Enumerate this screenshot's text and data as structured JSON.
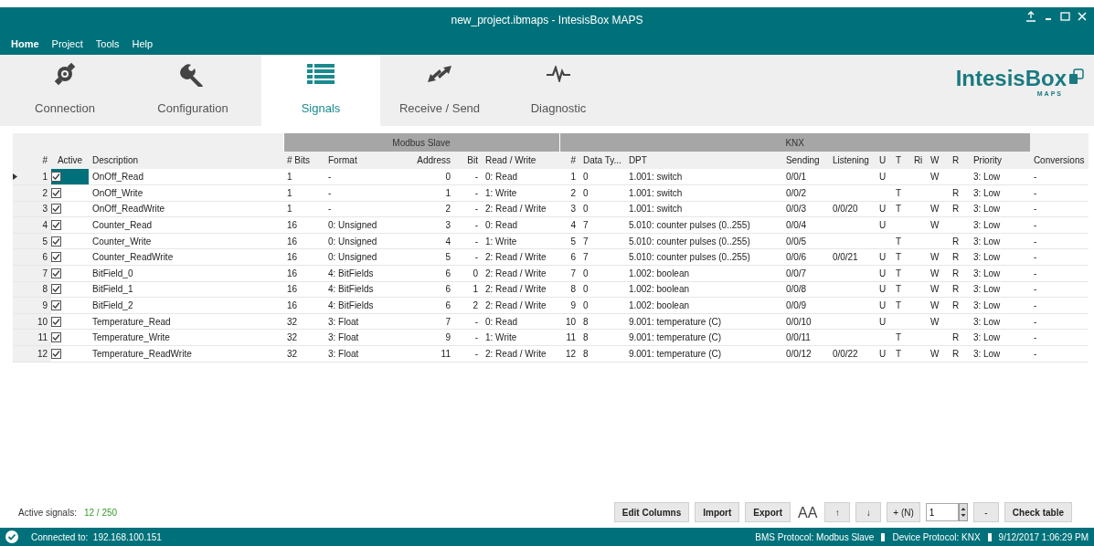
{
  "window": {
    "title": "new_project.ibmaps - IntesisBox MAPS"
  },
  "menu": [
    {
      "label": "Home",
      "selected": true
    },
    {
      "label": "Project",
      "selected": false
    },
    {
      "label": "Tools",
      "selected": false
    },
    {
      "label": "Help",
      "selected": false
    }
  ],
  "tabs": [
    {
      "label": "Connection",
      "kind": "connection",
      "selected": false
    },
    {
      "label": "Configuration",
      "kind": "configuration",
      "selected": false
    },
    {
      "label": "Signals",
      "kind": "signals",
      "selected": true
    },
    {
      "label": "Receive / Send",
      "kind": "receive",
      "selected": false
    },
    {
      "label": "Diagnostic",
      "kind": "diagnostic",
      "selected": false
    }
  ],
  "logo": {
    "name": "IntesisBox",
    "sub": "MAPS"
  },
  "table": {
    "sections": [
      {
        "columns": [
          "#",
          "Active",
          "Description"
        ]
      },
      {
        "label": "Modbus Slave",
        "columns": [
          "# Bits",
          "Format",
          "Address",
          "Bit",
          "Read / Write"
        ]
      },
      {
        "label": "KNX",
        "columns": [
          "#",
          "Data Ty...",
          "DPT",
          "Sending",
          "Listening",
          "U",
          "T",
          "Ri",
          "W",
          "R",
          "Priority"
        ]
      },
      {
        "columns": [
          "Conversions"
        ]
      }
    ],
    "rows": [
      {
        "selected": true,
        "active": true,
        "cells": [
          "1",
          "OnOff_Read",
          "1",
          "-",
          "0",
          "-",
          "0: Read",
          "1",
          "0",
          "1.001: switch",
          "0/0/1",
          null,
          "U",
          null,
          null,
          "W",
          null,
          "3: Low",
          "-"
        ]
      },
      {
        "selected": false,
        "active": true,
        "cells": [
          "2",
          "OnOff_Write",
          "1",
          "-",
          "1",
          "-",
          "1: Write",
          "2",
          "0",
          "1.001: switch",
          "0/0/2",
          null,
          null,
          "T",
          null,
          null,
          "R",
          "3: Low",
          "-"
        ]
      },
      {
        "selected": false,
        "active": true,
        "cells": [
          "3",
          "OnOff_ReadWrite",
          "1",
          "-",
          "2",
          "-",
          "2: Read / Write",
          "3",
          "0",
          "1.001: switch",
          "0/0/3",
          "0/0/20",
          "U",
          "T",
          null,
          "W",
          "R",
          "3: Low",
          "-"
        ]
      },
      {
        "selected": false,
        "active": true,
        "cells": [
          "4",
          "Counter_Read",
          "16",
          "0: Unsigned",
          "3",
          "-",
          "0: Read",
          "4",
          "7",
          "5.010: counter pulses (0..255)",
          "0/0/4",
          null,
          "U",
          null,
          null,
          "W",
          null,
          "3: Low",
          "-"
        ]
      },
      {
        "selected": false,
        "active": true,
        "cells": [
          "5",
          "Counter_Write",
          "16",
          "0: Unsigned",
          "4",
          "-",
          "1: Write",
          "5",
          "7",
          "5.010: counter pulses (0..255)",
          "0/0/5",
          null,
          null,
          "T",
          null,
          null,
          "R",
          "3: Low",
          "-"
        ]
      },
      {
        "selected": false,
        "active": true,
        "cells": [
          "6",
          "Counter_ReadWrite",
          "16",
          "0: Unsigned",
          "5",
          "-",
          "2: Read / Write",
          "6",
          "7",
          "5.010: counter pulses (0..255)",
          "0/0/6",
          "0/0/21",
          "U",
          "T",
          null,
          "W",
          "R",
          "3: Low",
          "-"
        ]
      },
      {
        "selected": false,
        "active": true,
        "cells": [
          "7",
          "BitField_0",
          "16",
          "4: BitFields",
          "6",
          "0",
          "2: Read / Write",
          "7",
          "0",
          "1.002: boolean",
          "0/0/7",
          null,
          "U",
          "T",
          null,
          "W",
          "R",
          "3: Low",
          "-"
        ]
      },
      {
        "selected": false,
        "active": true,
        "cells": [
          "8",
          "BitField_1",
          "16",
          "4: BitFields",
          "6",
          "1",
          "2: Read / Write",
          "8",
          "0",
          "1.002: boolean",
          "0/0/8",
          null,
          "U",
          "T",
          null,
          "W",
          "R",
          "3: Low",
          "-"
        ]
      },
      {
        "selected": false,
        "active": true,
        "cells": [
          "9",
          "BitField_2",
          "16",
          "4: BitFields",
          "6",
          "2",
          "2: Read / Write",
          "9",
          "0",
          "1.002: boolean",
          "0/0/9",
          null,
          "U",
          "T",
          null,
          "W",
          "R",
          "3: Low",
          "-"
        ]
      },
      {
        "selected": false,
        "active": true,
        "cells": [
          "10",
          "Temperature_Read",
          "32",
          "3: Float",
          "7",
          "-",
          "0: Read",
          "10",
          "8",
          "9.001: temperature (C)",
          "0/0/10",
          null,
          "U",
          null,
          null,
          "W",
          null,
          "3: Low",
          "-"
        ]
      },
      {
        "selected": false,
        "active": true,
        "cells": [
          "11",
          "Temperature_Write",
          "32",
          "3: Float",
          "9",
          "-",
          "1: Write",
          "11",
          "8",
          "9.001: temperature (C)",
          "0/0/11",
          null,
          null,
          "T",
          null,
          null,
          "R",
          "3: Low",
          "-"
        ]
      },
      {
        "selected": false,
        "active": true,
        "cells": [
          "12",
          "Temperature_ReadWrite",
          "32",
          "3: Float",
          "11",
          "-",
          "2: Read / Write",
          "12",
          "8",
          "9.001: temperature (C)",
          "0/0/12",
          "0/0/22",
          "U",
          "T",
          null,
          "W",
          "R",
          "3: Low",
          "-"
        ]
      }
    ]
  },
  "footer": {
    "label": "Active signals:",
    "count": "12 / 250",
    "buttons": [
      {
        "kind": "button",
        "label": "Edit Columns"
      },
      {
        "kind": "button",
        "label": "Import"
      },
      {
        "kind": "button",
        "label": "Export"
      },
      {
        "kind": "font",
        "label": "AA"
      },
      {
        "kind": "small",
        "label": "↑"
      },
      {
        "kind": "small",
        "label": "↓"
      },
      {
        "kind": "small",
        "label": "+ (N)"
      },
      {
        "kind": "spinner",
        "value": "1"
      },
      {
        "kind": "small",
        "label": "-"
      },
      {
        "kind": "button",
        "label": "Check table"
      }
    ]
  },
  "status_bar": {
    "connection": "Connected to:  192.168.100.151",
    "items": [
      "BMS Protocol: Modbus Slave",
      "Device Protocol: KNX",
      "9/12/2017 1:06:29 PM"
    ]
  }
}
